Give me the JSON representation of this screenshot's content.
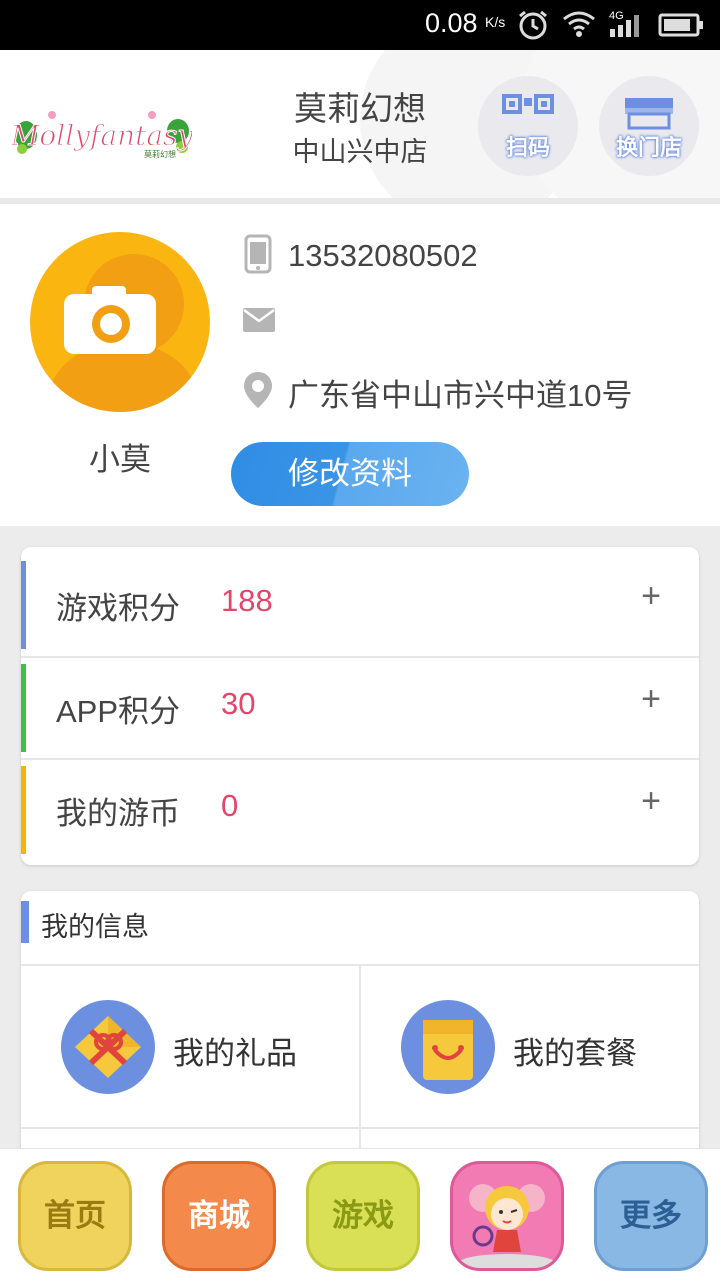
{
  "status_bar": {
    "speed": "0.08",
    "speed_unit": "K/s",
    "network": "4G"
  },
  "header": {
    "logo_text": "Mollyfantasy",
    "logo_sub": "莫莉幻想",
    "store_name": "莫莉幻想",
    "store_branch": "中山兴中店",
    "scan_label": "扫码",
    "switch_store_label": "换门店"
  },
  "profile": {
    "nickname": "小莫",
    "phone": "13532080502",
    "email": "",
    "address": "广东省中山市兴中道10号",
    "edit_label": "修改资料"
  },
  "points": [
    {
      "label": "游戏积分",
      "value": "188",
      "accent": "#6d8fe0"
    },
    {
      "label": "APP积分",
      "value": "30",
      "accent": "#3fbf4a"
    },
    {
      "label": "我的游币",
      "value": "0",
      "accent": "#f5b400"
    }
  ],
  "my_info": {
    "title": "我的信息",
    "items": [
      {
        "label": "我的礼品",
        "icon": "gift-icon"
      },
      {
        "label": "我的套餐",
        "icon": "shopping-bag-icon"
      }
    ]
  },
  "nav": [
    {
      "label": "首页",
      "bg": "#f0d35c",
      "color": "#9a7b12"
    },
    {
      "label": "商城",
      "bg": "#f3894b",
      "color": "#ffffff"
    },
    {
      "label": "游戏",
      "bg": "#d9e056",
      "color": "#8a9a14"
    },
    {
      "label": "",
      "bg": "#f27bb4",
      "color": "#ffffff"
    },
    {
      "label": "更多",
      "bg": "#8ab8e4",
      "color": "#2c5f93"
    }
  ],
  "colors": {
    "accent_blue": "#2f8de4",
    "value_red": "#e3466b",
    "avatar_orange": "#fbb511"
  }
}
